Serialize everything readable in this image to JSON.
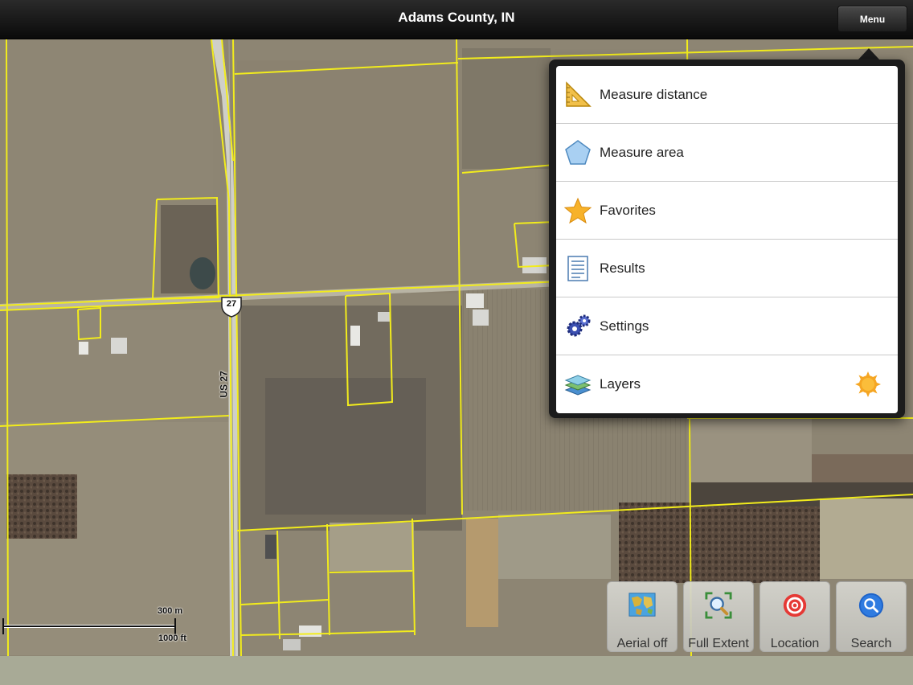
{
  "header": {
    "title": "Adams County, IN",
    "menu_label": "Menu"
  },
  "map": {
    "road_label": "US 27",
    "shield_label": "27",
    "scale": {
      "metric": "300 m",
      "imperial": "1000 ft"
    }
  },
  "menu": {
    "items": [
      {
        "label": "Measure distance",
        "icon": "ruler-triangle-icon"
      },
      {
        "label": "Measure area",
        "icon": "pentagon-icon"
      },
      {
        "label": "Favorites",
        "icon": "star-icon"
      },
      {
        "label": "Results",
        "icon": "document-list-icon"
      },
      {
        "label": "Settings",
        "icon": "gears-icon"
      },
      {
        "label": "Layers",
        "icon": "layers-icon",
        "badge": "sun-icon"
      }
    ]
  },
  "toolbar": {
    "aerial": "Aerial off",
    "full_extent": "Full Extent",
    "location": "Location",
    "search": "Search"
  },
  "colors": {
    "parcel_line": "#f2ec1c",
    "accent_orange": "#f5a623",
    "toolbar_bg": "#d0d0ca"
  }
}
